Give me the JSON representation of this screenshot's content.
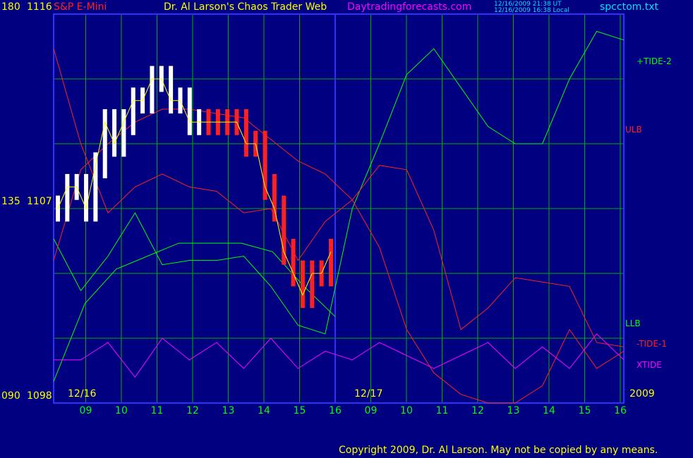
{
  "header": {
    "instrument": "S&P E-Mini",
    "title": "Dr. Al Larson's Chaos Trader Web",
    "site": "Daytradingforecasts.com",
    "stamp_ut": "12/16/2009 21:38 UT",
    "stamp_local": "12/16/2009 16:38 Local",
    "file": "spcctom.txt"
  },
  "y_axis_labels": {
    "top_angle": "180",
    "top_price": "1116",
    "mid_angle": "135",
    "mid_price": "1107",
    "bottom_angle": "090",
    "bottom_price": "1098"
  },
  "legend": {
    "tide2": "+TIDE-2",
    "ulb": "ULB",
    "llb": "LLB",
    "tide1": "-TIDE-1",
    "xtide": "XTIDE"
  },
  "date_labels": {
    "day1": "12/16",
    "day2": "12/17",
    "year": "2009"
  },
  "footer": {
    "copyright": "Copyright 2009, Dr. Al Larson. May not be copied by any means."
  },
  "colors": {
    "background": "#000080",
    "grid": "#00b000",
    "tide2": "#00ff00",
    "tide1": "#ff2020",
    "ulb": "#ff2020",
    "llb": "#00ff00",
    "xtide": "#ff00ff",
    "price_up": "#ffffff",
    "price_down": "#ff2020",
    "average": "#ffff00",
    "blue_curve": "#2020ff"
  },
  "chart_data": {
    "type": "line",
    "title": "Dr. Al Larson's Chaos Trader Web",
    "xlabel": "",
    "ylabel": "",
    "x_ticks": [
      "09",
      "10",
      "11",
      "12",
      "13",
      "14",
      "15",
      "16",
      "09",
      "10",
      "11",
      "12",
      "13",
      "14",
      "15",
      "16"
    ],
    "ylim": [
      1098,
      1116
    ],
    "angle_range": [
      90,
      180
    ],
    "price_ticks": [
      1098,
      1107,
      1116
    ],
    "grid": true,
    "series": [
      {
        "name": "+TIDE-2",
        "values": [
          128,
          116,
          124,
          134,
          122,
          123,
          123,
          124,
          117,
          108,
          106,
          135,
          150,
          166,
          172,
          163,
          154,
          150,
          150,
          165,
          176,
          174
        ]
      },
      {
        "name": "ULB",
        "values": [
          123,
          144,
          150,
          155,
          158,
          158,
          157,
          156,
          151,
          146,
          143,
          137,
          126,
          107,
          97,
          92,
          90,
          90,
          94,
          107,
          98,
          102
        ]
      },
      {
        "name": "LLB",
        "values": [
          95,
          113,
          121,
          124,
          127,
          127,
          127,
          125,
          117,
          110
        ]
      },
      {
        "name": "-TIDE-1",
        "values": [
          172,
          150,
          134,
          140,
          143,
          140,
          139,
          134,
          135,
          123,
          132,
          137,
          145,
          144,
          130,
          107,
          112,
          119,
          118,
          117,
          104,
          103
        ]
      },
      {
        "name": "XTIDE",
        "values": [
          100,
          100,
          104,
          96,
          105,
          100,
          104,
          98,
          105,
          98,
          102,
          100,
          104,
          101,
          98,
          101,
          104,
          98,
          103,
          98,
          106,
          100
        ]
      }
    ],
    "price_bars_1107_scale": [
      1107,
      1108,
      1108,
      1107,
      1109,
      1111,
      1110,
      1111,
      1112,
      1112,
      1113,
      1113,
      1112,
      1112,
      1111,
      1111,
      1111,
      1111,
      1111,
      1111,
      1110,
      1110,
      1108,
      1107,
      1105,
      1104,
      1103,
      1104,
      1104,
      1105
    ]
  }
}
